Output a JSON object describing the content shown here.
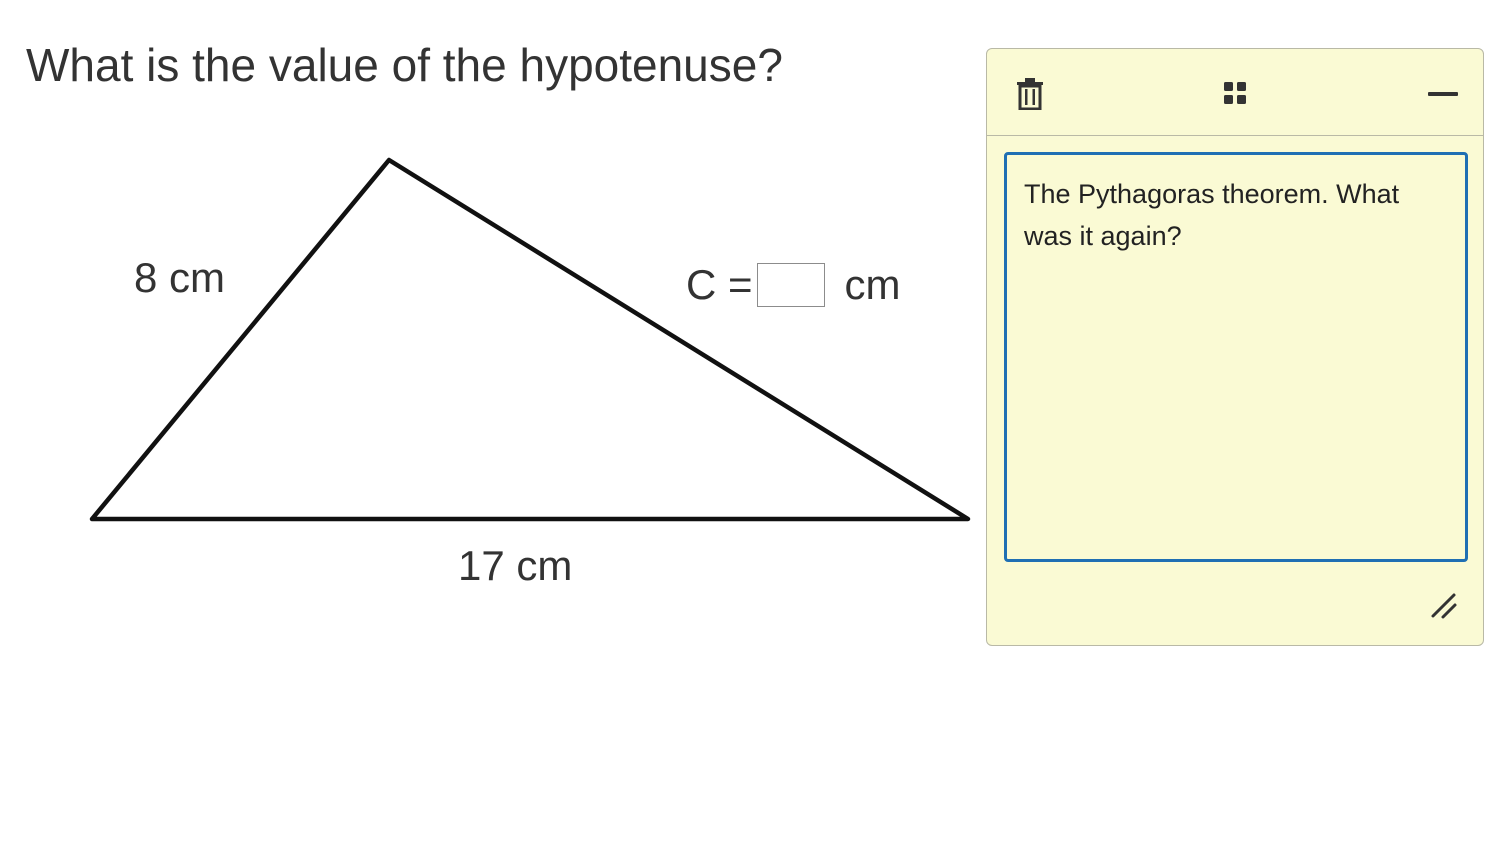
{
  "question": {
    "text": "What is the value of the hypotenuse?"
  },
  "triangle": {
    "side_a_label": "8 cm",
    "side_b_label": "17 cm",
    "hypotenuse": {
      "variable": "C =",
      "input_value": "",
      "unit": "cm"
    }
  },
  "note": {
    "text": "The Pythagoras theorem. What was it again?",
    "icons": {
      "delete": "trash-icon",
      "move": "drag-grid-icon",
      "minimize": "minus-icon",
      "resize": "resize-handle-icon"
    },
    "colors": {
      "background": "#fafad4",
      "focus_border": "#1f6fb3"
    }
  }
}
